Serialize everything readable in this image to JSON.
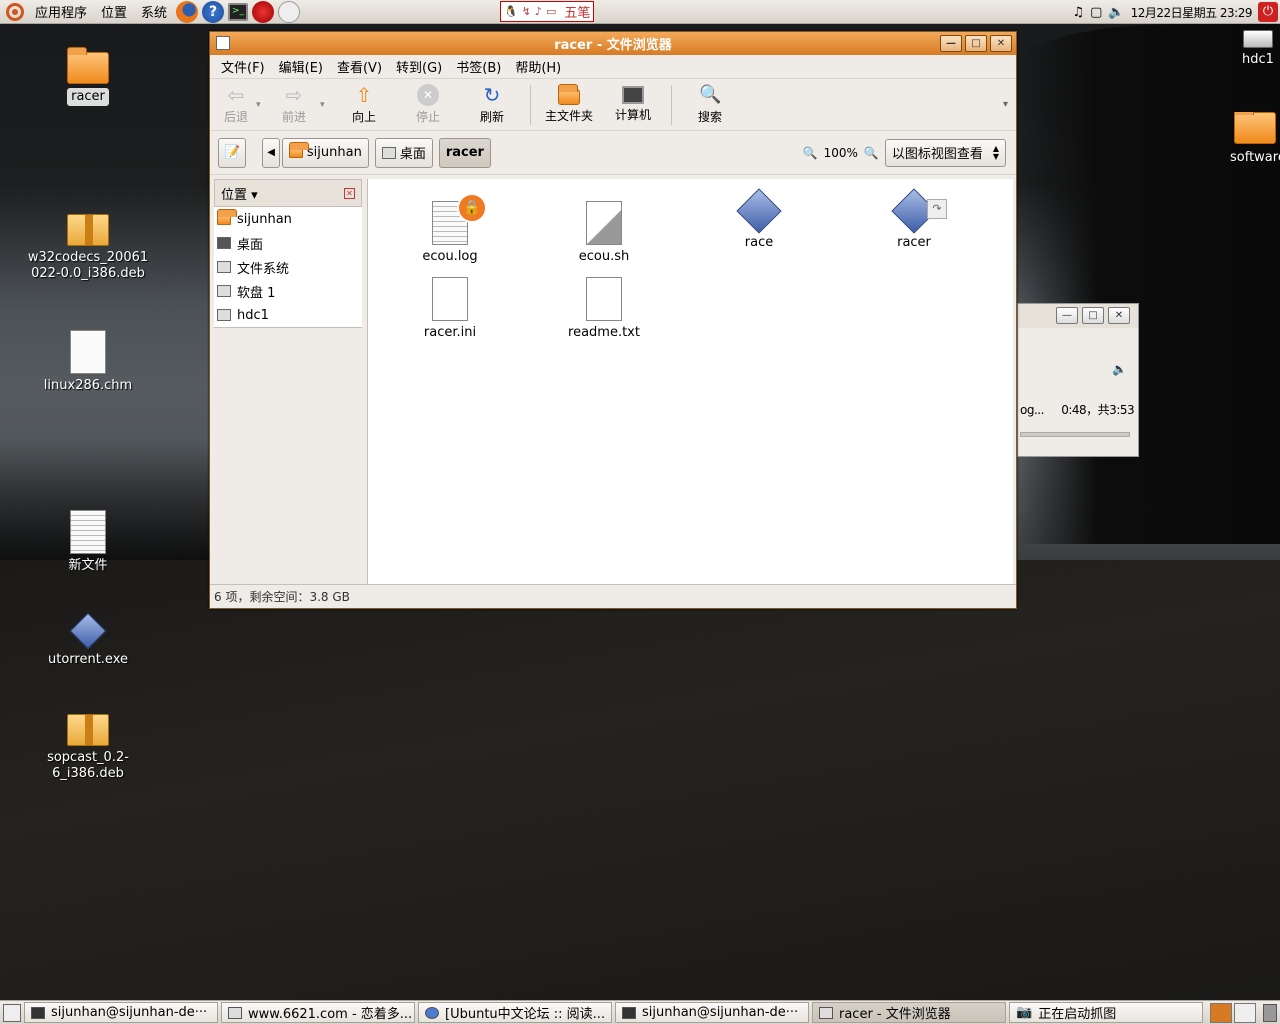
{
  "top_panel": {
    "menus": [
      "应用程序",
      "位置",
      "系统"
    ],
    "launchers": [
      "firefox-icon",
      "help-icon",
      "terminal-icon",
      "mail-icon",
      "clock-app-icon"
    ],
    "ime_mode": "五笔",
    "clock": "12月22日星期五 23:29"
  },
  "desktop_icons": [
    {
      "label": "racer",
      "icon": "folder-icon"
    },
    {
      "label": "w32codecs_20061022-0.0_i386.deb",
      "icon": "package-icon"
    },
    {
      "label": "linux286.chm",
      "icon": "document-icon"
    },
    {
      "label": "新文件",
      "icon": "text-file-icon"
    },
    {
      "label": "utorrent.exe",
      "icon": "executable-icon"
    },
    {
      "label": "sopcast_0.2-6_i386.deb",
      "icon": "package-icon"
    },
    {
      "label": "hdc1",
      "icon": "drive-icon"
    },
    {
      "label": "software",
      "icon": "folder-icon"
    }
  ],
  "file_browser": {
    "title": "racer - 文件浏览器",
    "menubar": [
      "文件(F)",
      "编辑(E)",
      "查看(V)",
      "转到(G)",
      "书签(B)",
      "帮助(H)"
    ],
    "toolbar": {
      "back": "后退",
      "forward": "前进",
      "up": "向上",
      "stop": "停止",
      "reload": "刷新",
      "home": "主文件夹",
      "computer": "计算机",
      "search": "搜索"
    },
    "path": [
      "sijunhan",
      "桌面",
      "racer"
    ],
    "zoom": "100%",
    "view_mode": "以图标视图查看",
    "sidebar_title": "位置",
    "places": [
      "sijunhan",
      "桌面",
      "文件系统",
      "软盘 1",
      "hdc1"
    ],
    "files": [
      {
        "name": "ecou.log",
        "badge": "lock"
      },
      {
        "name": "ecou.sh",
        "badge": ""
      },
      {
        "name": "race",
        "badge": ""
      },
      {
        "name": "racer",
        "badge": "link"
      },
      {
        "name": "racer.ini",
        "badge": ""
      },
      {
        "name": "readme.txt",
        "badge": ""
      }
    ],
    "status": "6 项，剩余空间：3.8 GB"
  },
  "media_window": {
    "track_fragment": "og...",
    "time": "0:48，共3:53"
  },
  "taskbar": [
    "sijunhan@sijunhan-de···",
    "www.6621.com - 恋着多...",
    "[Ubuntu中文论坛 :: 阅读...",
    "sijunhan@sijunhan-de···",
    "racer - 文件浏览器",
    "正在启动抓图"
  ]
}
